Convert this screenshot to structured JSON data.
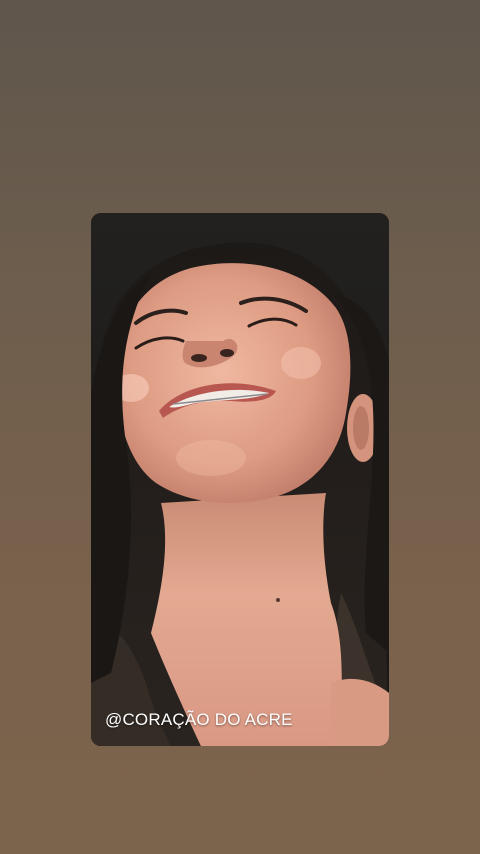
{
  "story": {
    "watermark": "@CORAÇÃO DO ACRE"
  },
  "colors": {
    "background_top": "#5f564c",
    "background_bottom": "#7c634c",
    "photo_backdrop": "#1e1d1b",
    "skin": "#e2a189",
    "hair": "#1a1614"
  }
}
